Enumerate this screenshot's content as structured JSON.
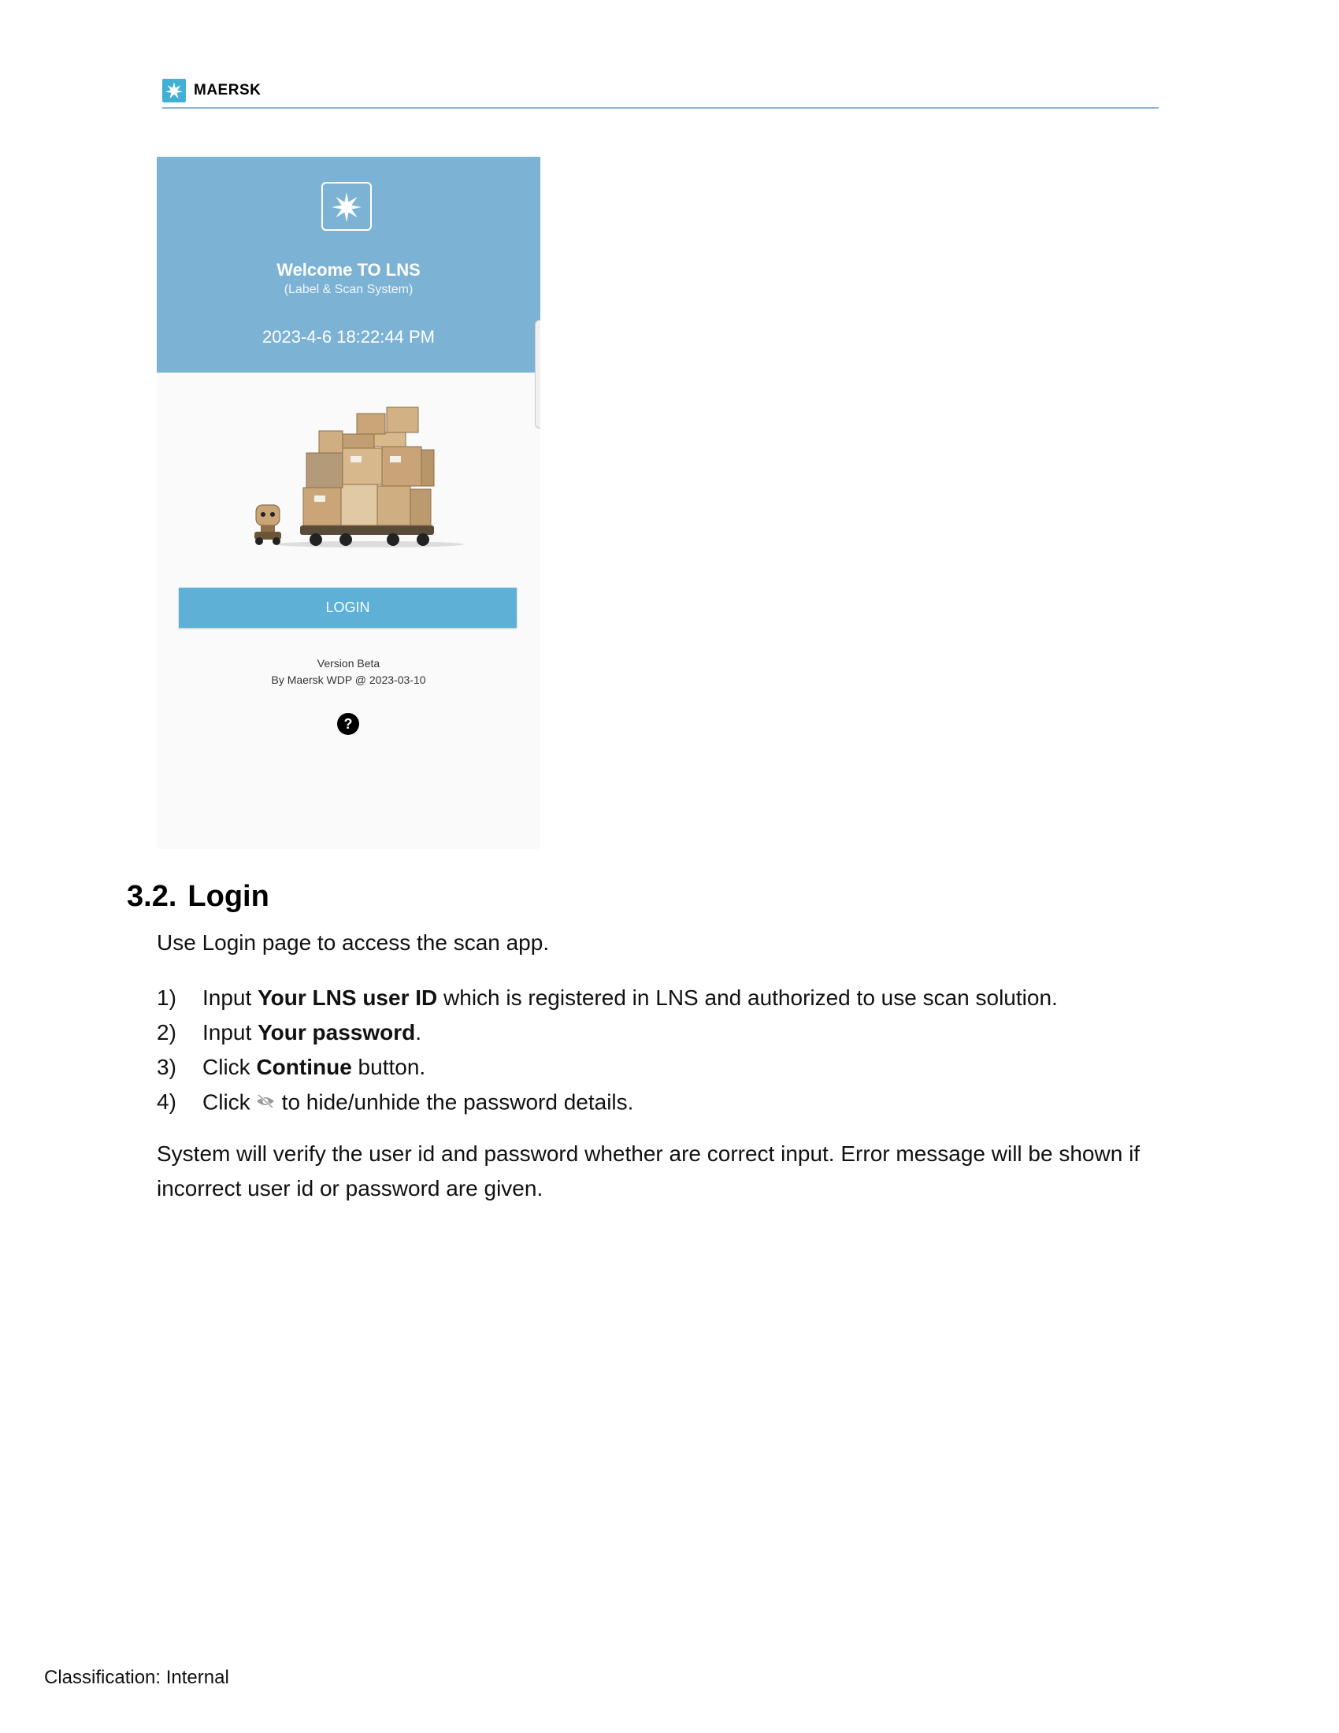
{
  "header": {
    "brand": "MAERSK"
  },
  "app_screen": {
    "welcome_title": "Welcome TO LNS",
    "welcome_subtitle": "(Label & Scan System)",
    "datetime": "2023-4-6  18:22:44 PM",
    "login_label": "LOGIN",
    "version_line1": "Version Beta",
    "version_line2": "By Maersk WDP @ 2023-03-10",
    "help_label": "?"
  },
  "section": {
    "number": "3.2.",
    "title": "Login",
    "intro": "Use Login page to access the scan app.",
    "steps": [
      {
        "num": "1)",
        "pre": "Input ",
        "bold": "Your LNS user ID",
        "post": " which is registered in LNS and authorized to use scan solution."
      },
      {
        "num": "2)",
        "pre": "Input ",
        "bold": "Your password",
        "post": "."
      },
      {
        "num": "3)",
        "pre": "Click ",
        "bold": "Continue",
        "post": " button."
      },
      {
        "num": "4)",
        "pre": "Click",
        "icon": "eye-slash-icon",
        "post": "to hide/unhide the password details."
      }
    ],
    "summary": "System will verify the user id and password whether are correct input. Error message will be shown if incorrect user id or password are given."
  },
  "footer": {
    "classification": "Classification: Internal"
  },
  "colors": {
    "brand_blue": "#42b0d5",
    "header_panel": "#7cb3d4",
    "login_button": "#5fb0d6"
  }
}
